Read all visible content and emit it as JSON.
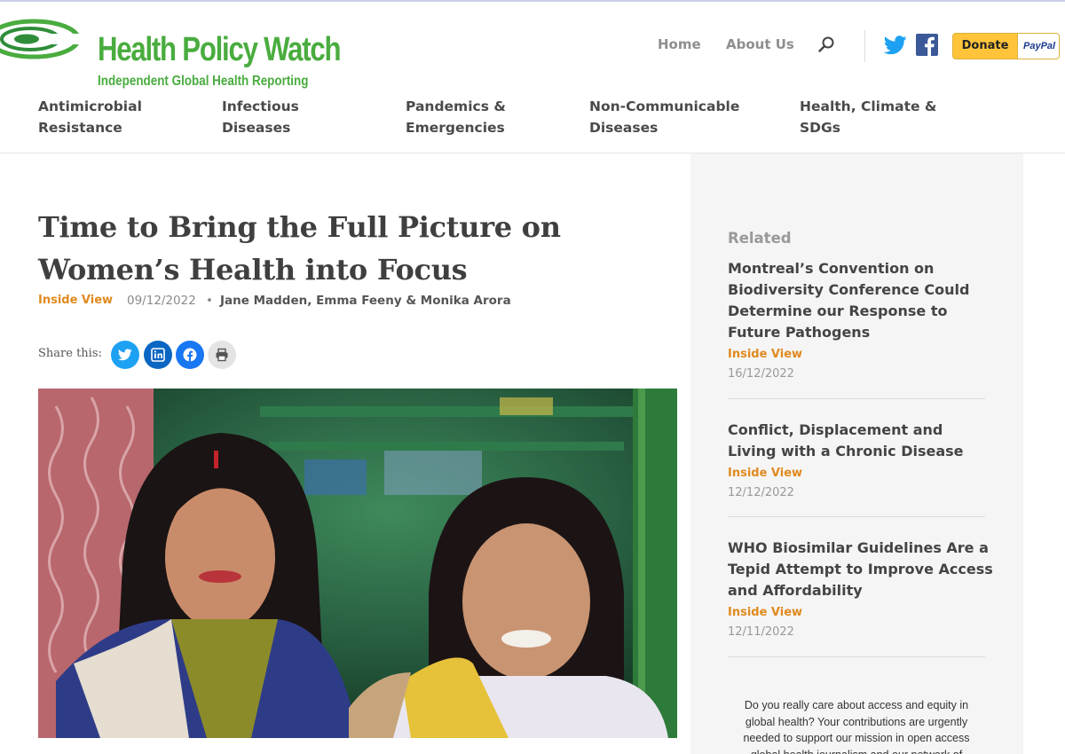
{
  "site": {
    "title": "Health Policy Watch",
    "tagline": "Independent Global Health Reporting",
    "brand_color": "#4aac3f"
  },
  "header": {
    "nav": [
      "Home",
      "About Us"
    ],
    "donate_label": "Donate",
    "paypal_label": "PayPal",
    "icons": [
      "search-icon",
      "twitter-icon",
      "facebook-icon"
    ]
  },
  "categories": [
    {
      "line1": "Antimicrobial",
      "line2": "Resistance"
    },
    {
      "line1": "Infectious",
      "line2": "Diseases"
    },
    {
      "line1": "Pandemics &",
      "line2": "Emergencies"
    },
    {
      "line1": "Non-Communicable",
      "line2": "Diseases"
    },
    {
      "line1": "Health, Climate &",
      "line2": "SDGs"
    }
  ],
  "article": {
    "title": "Time to Bring the Full Picture on Women’s Health into Focus",
    "category": "Inside View",
    "date": "09/12/2022",
    "separator": "•",
    "authors": "Jane Madden, Emma Feeny & Monika Arora",
    "share_label": "Share this:",
    "share_buttons": [
      "twitter",
      "linkedin",
      "facebook",
      "print"
    ]
  },
  "sidebar": {
    "heading": "Related",
    "items": [
      {
        "title": "Montreal’s Convention on Biodiversity Conference Could Determine our Response to Future Pathogens",
        "category": "Inside View",
        "date": "16/12/2022"
      },
      {
        "title": "Conflict, Displacement and Living with a Chronic Disease",
        "category": "Inside View",
        "date": "12/12/2022"
      },
      {
        "title": "WHO Biosimilar Guidelines Are a Tepid Attempt to Improve Access and Affordability",
        "category": "Inside View",
        "date": "12/11/2022"
      }
    ],
    "pitch": "Do you really care about access and equity in global health? Your contributions are urgently needed to support our mission in open access global health journalism and our network of"
  },
  "colors": {
    "accent_orange": "#e08a1e",
    "donate_yellow": "#ffc43a",
    "twitter": "#1da1f2",
    "linkedin": "#0a66c2",
    "facebook": "#1877f2"
  }
}
